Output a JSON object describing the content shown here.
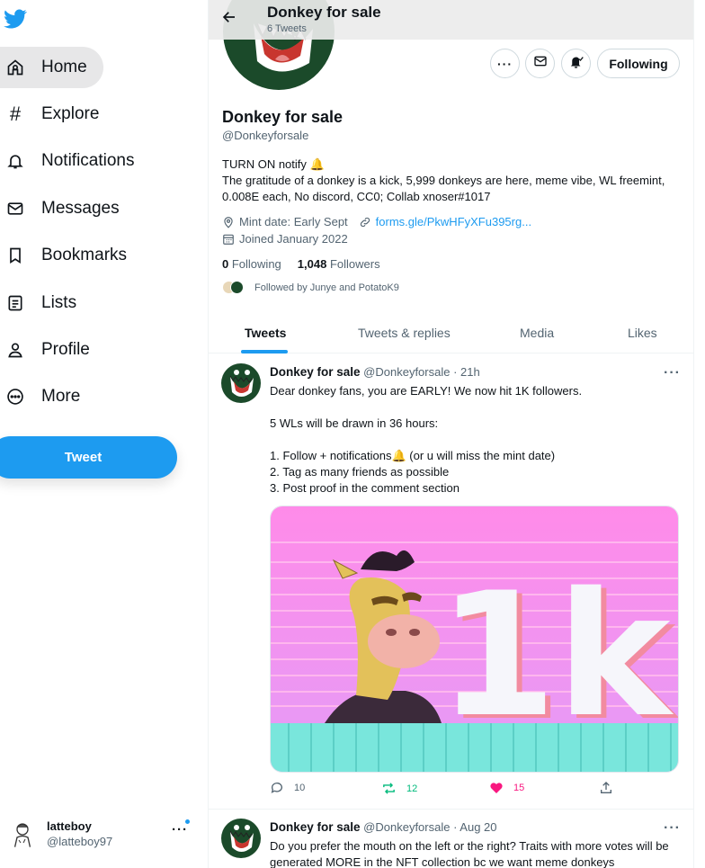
{
  "sidebar": {
    "items": [
      {
        "label": "Home",
        "icon": "home-icon"
      },
      {
        "label": "Explore",
        "icon": "hashtag-icon"
      },
      {
        "label": "Notifications",
        "icon": "bell-icon"
      },
      {
        "label": "Messages",
        "icon": "envelope-icon"
      },
      {
        "label": "Bookmarks",
        "icon": "bookmark-icon"
      },
      {
        "label": "Lists",
        "icon": "list-icon"
      },
      {
        "label": "Profile",
        "icon": "person-icon"
      },
      {
        "label": "More",
        "icon": "more-circle-icon"
      }
    ],
    "tweet_label": "Tweet",
    "account": {
      "name": "latteboy",
      "handle": "@latteboy97",
      "more": "···"
    }
  },
  "header": {
    "title": "Donkey for sale",
    "subtitle": "6 Tweets"
  },
  "profile": {
    "follow_label": "Following",
    "more_label": "···",
    "name": "Donkey for sale",
    "handle": "@Donkeyforsale",
    "bio_line1": "TURN ON notify 🔔",
    "bio_line2": "The gratitude of a donkey is a kick, 5,999 donkeys are here, meme vibe, WL freemint, 0.008E each, No discord, CC0; Collab xnoser#1017",
    "mint_date": "Mint date: Early Sept",
    "link": "forms.gle/PkwHFyXFu395rg...",
    "joined": "Joined January 2022",
    "following_count": "0",
    "following_label": "Following",
    "followers_count": "1,048",
    "followers_label": "Followers",
    "followed_by": "Followed by Junye and PotatoK9"
  },
  "tabs": [
    "Tweets",
    "Tweets & replies",
    "Media",
    "Likes"
  ],
  "tweets": [
    {
      "name": "Donkey for sale",
      "meta": "@Donkeyforsale · 21h",
      "more": "···",
      "lines": [
        "Dear donkey fans, you are EARLY! We now hit 1K followers.",
        "5 WLs will be drawn in 36 hours:",
        "1. Follow + notifications🔔 (or u will miss the mint date)",
        "2. Tag as many friends as possible",
        "3. Post proof in the comment section"
      ],
      "media_text": "1k",
      "replies": "10",
      "retweets": "12",
      "likes": "15",
      "colors": {
        "retweet": "#00ba7c",
        "like": "#f91880"
      }
    },
    {
      "name": "Donkey for sale",
      "meta": "@Donkeyforsale · Aug 20",
      "more": "···",
      "text": "Do you prefer the mouth on the left or the right? Traits with more votes will be generated MORE in the NFT collection bc we want meme donkeys"
    }
  ],
  "colors": {
    "accent": "#1d9bf0",
    "text": "#0f1419",
    "muted": "#536471"
  }
}
